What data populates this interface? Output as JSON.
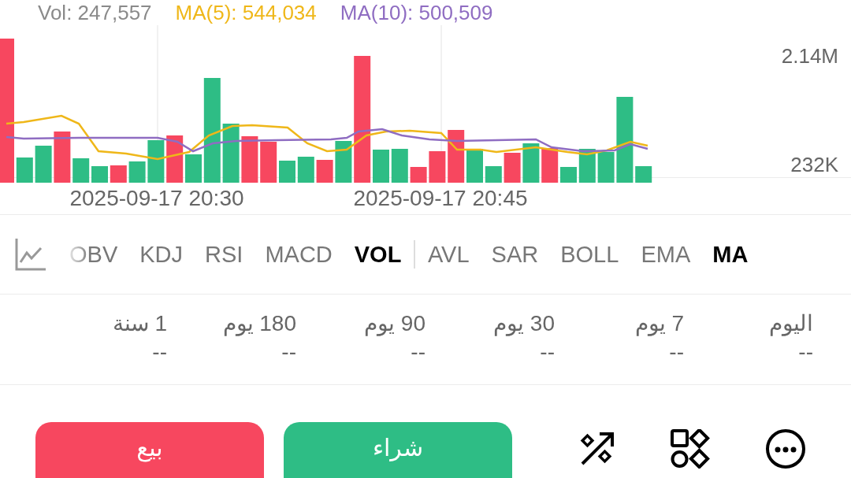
{
  "legend": [
    {
      "kind": "ma10",
      "text": "MA(10): 500,509"
    },
    {
      "kind": "ma5",
      "text": "MA(5): 544,034"
    },
    {
      "kind": "vol",
      "text": "Vol: 247,557"
    }
  ],
  "axis_labels": [
    "2.14M",
    "232K"
  ],
  "time_labels": [
    "2025-09-17 20:45",
    "2025-09-17 20:30"
  ],
  "indicator_groups": [
    {
      "tabs": [
        {
          "label": "MA",
          "selected": true
        },
        {
          "label": "EMA",
          "selected": false
        },
        {
          "label": "BOLL",
          "selected": false
        },
        {
          "label": "SAR",
          "selected": false
        },
        {
          "label": "AVL",
          "selected": false
        }
      ]
    },
    {
      "tabs": [
        {
          "label": "VOL",
          "selected": true
        },
        {
          "label": "MACD",
          "selected": false
        },
        {
          "label": "RSI",
          "selected": false
        },
        {
          "label": "KDJ",
          "selected": false
        },
        {
          "label": "OBV",
          "selected": false
        }
      ]
    }
  ],
  "periods": [
    {
      "label": "اليوم",
      "value": "--"
    },
    {
      "label": "7 يوم",
      "value": "--"
    },
    {
      "label": "30 يوم",
      "value": "--"
    },
    {
      "label": "90 يوم",
      "value": "--"
    },
    {
      "label": "180 يوم",
      "value": "--"
    },
    {
      "label": "1 سنة",
      "value": "--"
    }
  ],
  "actions": [
    {
      "kind": "buy",
      "label": "شراء"
    },
    {
      "kind": "sell",
      "label": "بيع"
    }
  ]
}
